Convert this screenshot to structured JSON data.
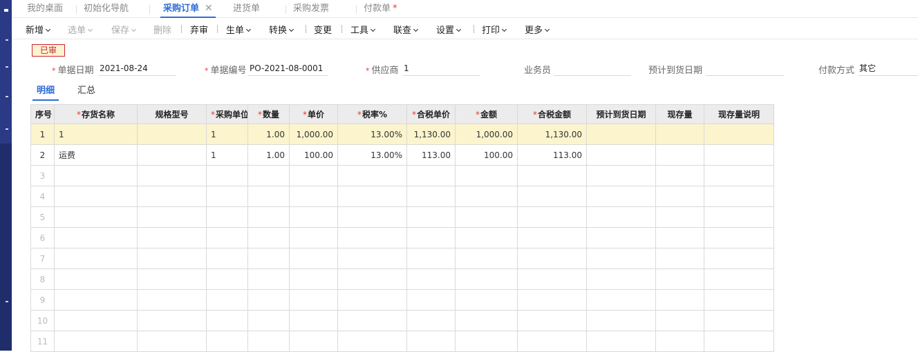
{
  "tabs": [
    {
      "label": "我的桌面",
      "active": false
    },
    {
      "label": "初始化导航",
      "active": false
    },
    {
      "label": "采购订单",
      "active": true,
      "closable": true
    },
    {
      "label": "进货单",
      "active": false
    },
    {
      "label": "采购发票",
      "active": false
    },
    {
      "label": "付款单",
      "active": false,
      "dirty": true
    }
  ],
  "tab_close_glyph": "✕",
  "tab_dirty_glyph": "*",
  "toolbar": {
    "new": "新增",
    "select": "选单",
    "save": "保存",
    "delete": "删除",
    "abandon": "弃审",
    "generate": "生单",
    "convert": "转换",
    "change": "变更",
    "tools": "工具",
    "link": "联查",
    "settings": "设置",
    "print": "打印",
    "more": "更多"
  },
  "status_badge": "已审",
  "form": {
    "date_label": "单据日期",
    "date_value": "2021-08-24",
    "number_label": "单据编号",
    "number_value": "PO-2021-08-0001",
    "supplier_label": "供应商",
    "supplier_value": "1",
    "salesman_label": "业务员",
    "salesman_value": "",
    "arrival_label": "预计到货日期",
    "arrival_value": "",
    "payment_label": "付款方式",
    "payment_value": "其它",
    "required_mark": "*"
  },
  "subtabs": {
    "detail": "明细",
    "summary": "汇总"
  },
  "grid": {
    "headers": {
      "idx": "序号",
      "name": "存货名称",
      "spec": "规格型号",
      "unit": "采购单位",
      "qty": "数量",
      "price": "单价",
      "tax_rate": "税率%",
      "tax_price": "合税单价",
      "amount": "金额",
      "tax_amount": "合税金额",
      "arrival": "预计到货日期",
      "stock": "现存量",
      "stock_note": "现存量说明"
    },
    "rows": [
      {
        "idx": "1",
        "name": "1",
        "spec": "",
        "unit": "1",
        "qty": "1.00",
        "price": "1,000.00",
        "tax_rate": "13.00%",
        "tax_price": "1,130.00",
        "amount": "1,000.00",
        "tax_amount": "1,130.00",
        "arrival": "",
        "stock": "",
        "stock_note": ""
      },
      {
        "idx": "2",
        "name": "运费",
        "spec": "",
        "unit": "1",
        "qty": "1.00",
        "price": "100.00",
        "tax_rate": "13.00%",
        "tax_price": "113.00",
        "amount": "100.00",
        "tax_amount": "113.00",
        "arrival": "",
        "stock": "",
        "stock_note": ""
      },
      {
        "idx": "3"
      },
      {
        "idx": "4"
      },
      {
        "idx": "5"
      },
      {
        "idx": "6"
      },
      {
        "idx": "7"
      },
      {
        "idx": "8"
      },
      {
        "idx": "9"
      },
      {
        "idx": "10"
      },
      {
        "idx": "11"
      }
    ]
  },
  "colors": {
    "accent": "#2d6bd6",
    "sidebar": "#1f2d6b",
    "selected_row": "#fcf4cd",
    "required": "#e33333"
  }
}
